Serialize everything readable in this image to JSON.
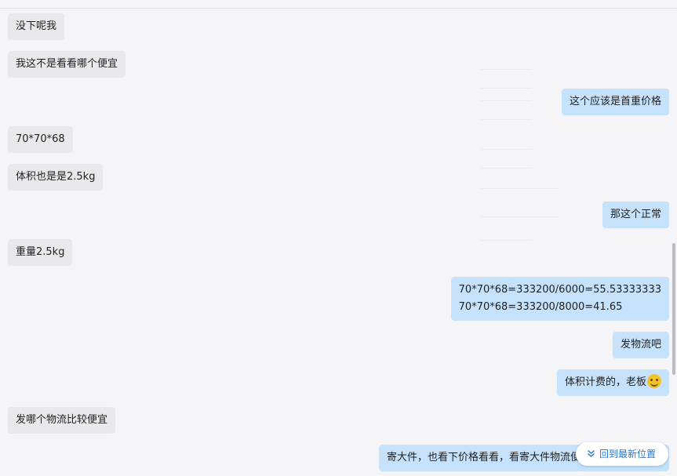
{
  "messages": [
    {
      "side": "left",
      "text": "没下呢我"
    },
    {
      "side": "left",
      "text": "我这不是看看哪个便宜"
    },
    {
      "side": "right",
      "text": "这个应该是首重价格"
    },
    {
      "side": "left",
      "text": "70*70*68"
    },
    {
      "side": "left",
      "text": "体积也是是2.5kg"
    },
    {
      "side": "right",
      "text": "那这个正常"
    },
    {
      "side": "left",
      "text": "重量2.5kg"
    },
    {
      "side": "right",
      "lines": [
        "70*70*68=333200/6000=55.53333333",
        "70*70*68=333200/8000=41.65"
      ]
    },
    {
      "side": "right",
      "text": "发物流吧"
    },
    {
      "side": "right",
      "text": "体积计费的，老板",
      "emoji": "laughing-emoji-icon"
    },
    {
      "side": "left",
      "text": "发哪个物流比较便宜"
    },
    {
      "side": "right",
      "text": "寄大件，也看下价格看看，看寄大件物流便"
    }
  ],
  "jump_button": {
    "label": "回到最新位置",
    "icon": "double-chevron-down-icon"
  },
  "colors": {
    "background": "#f5f5f7",
    "incoming_bubble": "#e9e9eb",
    "outgoing_bubble": "#c6e2fb",
    "link": "#1e78dc"
  }
}
